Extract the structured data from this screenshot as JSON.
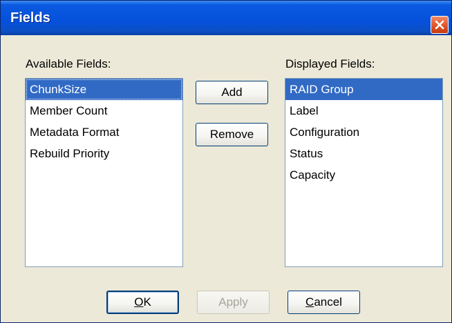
{
  "window": {
    "title": "Fields"
  },
  "available": {
    "label": "Available Fields:",
    "items": [
      "ChunkSize",
      "Member Count",
      "Metadata Format",
      "Rebuild Priority"
    ],
    "selected_index": 0
  },
  "displayed": {
    "label": "Displayed Fields:",
    "items": [
      "RAID Group",
      "Label",
      "Configuration",
      "Status",
      "Capacity"
    ],
    "selected_index": 0
  },
  "buttons": {
    "add": "Add",
    "remove": "Remove",
    "ok": {
      "mnemonic": "O",
      "rest": "K"
    },
    "apply": {
      "label": "Apply",
      "disabled": true
    },
    "cancel": {
      "mnemonic": "C",
      "rest": "ancel"
    }
  },
  "icons": {
    "close": "close-icon"
  },
  "colors": {
    "titlebar": "#0550dc",
    "selection": "#316ac5",
    "close_button": "#e25a2e",
    "dialog_bg": "#ece9d8"
  }
}
